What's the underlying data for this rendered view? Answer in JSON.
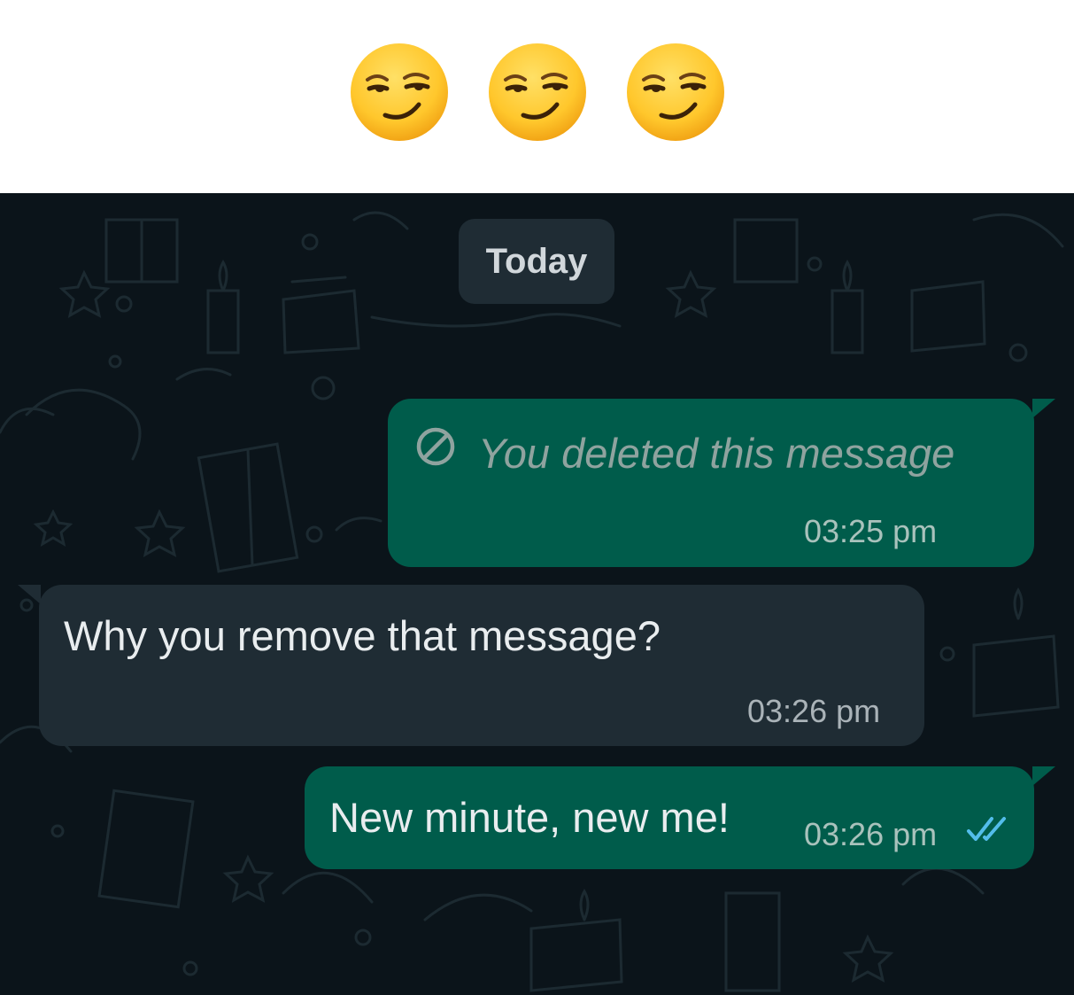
{
  "caption": {
    "emojis": [
      "smirking-face",
      "smirking-face",
      "smirking-face"
    ]
  },
  "chat": {
    "date_separator": "Today",
    "messages": [
      {
        "direction": "outgoing",
        "deleted": true,
        "text": "You deleted this message",
        "time": "03:25 pm",
        "icon": "deleted-icon"
      },
      {
        "direction": "incoming",
        "deleted": false,
        "text": "Why you remove that message?",
        "time": "03:26 pm"
      },
      {
        "direction": "outgoing",
        "deleted": false,
        "text": "New minute, new me!",
        "time": "03:26 pm",
        "status": "read",
        "icon": "double-check-icon"
      }
    ]
  },
  "colors": {
    "chat_background": "#0b141a",
    "outgoing_bubble": "#005c4b",
    "incoming_bubble": "#1f2c34",
    "read_ticks": "#53bdeb",
    "emoji_face": "#ffcc33"
  }
}
